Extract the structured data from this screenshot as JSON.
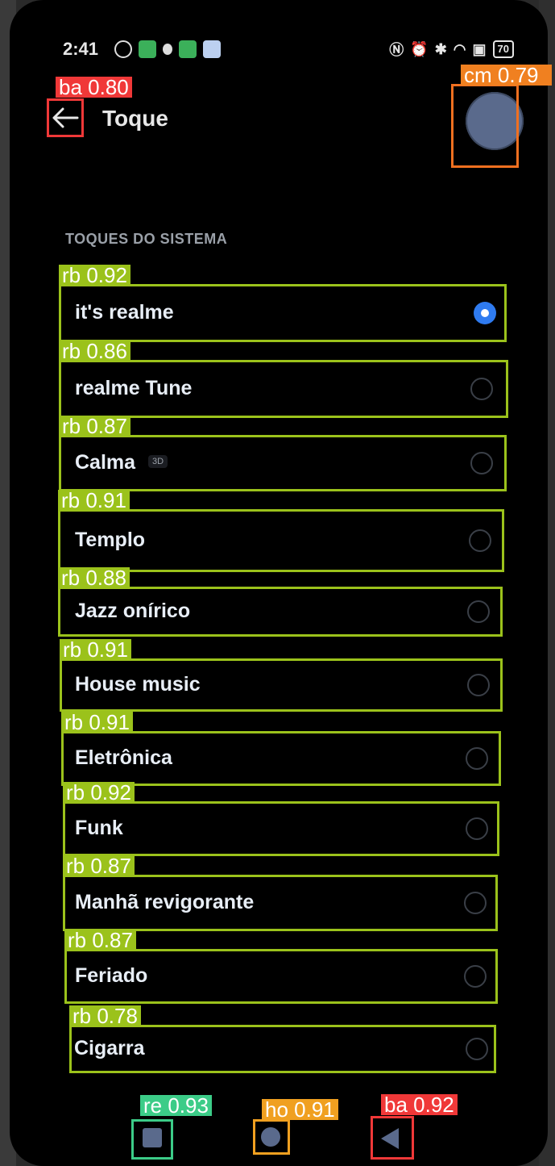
{
  "status_bar": {
    "time": "2:41",
    "battery": "70"
  },
  "header": {
    "title": "Toque",
    "back_icon": "arrow-left-icon",
    "avatar_icon": "circle-avatar-icon"
  },
  "section_title": "TOQUES DO SISTEMA",
  "ringtones": [
    {
      "label": "it's realme",
      "selected": true,
      "det": "rb 0.92"
    },
    {
      "label": "realme Tune",
      "selected": false,
      "det": "rb 0.86"
    },
    {
      "label": "Calma",
      "badge": "3D",
      "selected": false,
      "det": "rb 0.87"
    },
    {
      "label": "Templo",
      "selected": false,
      "det": "rb 0.91"
    },
    {
      "label": "Jazz onírico",
      "selected": false,
      "det": "rb 0.88"
    },
    {
      "label": "House music",
      "selected": false,
      "det": "rb 0.91"
    },
    {
      "label": "Eletrônica",
      "selected": false,
      "det": "rb 0.91"
    },
    {
      "label": "Funk",
      "selected": false,
      "det": "rb 0.92"
    },
    {
      "label": "Manhã revigorante",
      "selected": false,
      "det": "rb 0.87"
    },
    {
      "label": "Feriado",
      "selected": false,
      "det": "rb 0.87"
    },
    {
      "label": "Cigarra",
      "selected": false,
      "det": "rb 0.78"
    }
  ],
  "detections": {
    "back": "ba 0.80",
    "avatar": "cm 0.79",
    "nav_recent": "re 0.93",
    "nav_home": "ho 0.91",
    "nav_back": "ba 0.92"
  },
  "colors": {
    "accent": "#2f7bf0",
    "detection_box": "#9bc21b"
  }
}
